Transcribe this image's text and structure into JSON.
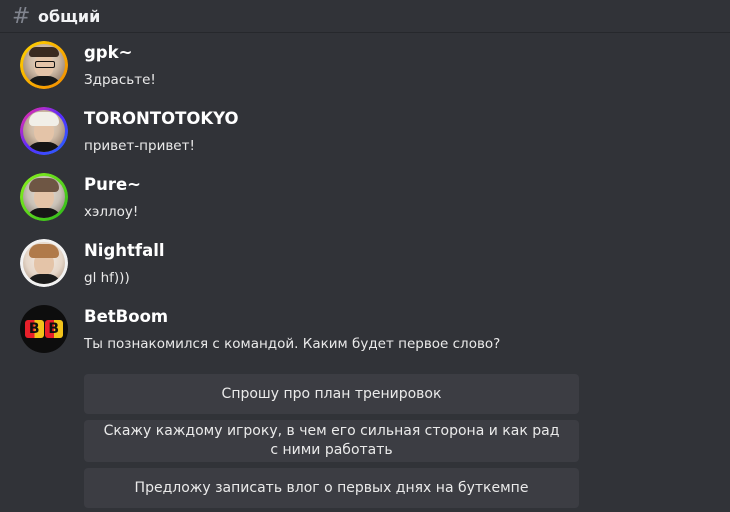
{
  "channel": {
    "hash_icon": "hash-icon",
    "name": "общий"
  },
  "messages": [
    {
      "username": "gpk~",
      "text": "Здрасьте!",
      "avatar_ring": "#f5b400"
    },
    {
      "username": "TORONTOTOKYO",
      "text": "привет-привет!",
      "avatar_ring": "#7b3cff"
    },
    {
      "username": "Pure~",
      "text": "хэллоу!",
      "avatar_ring": "#4cd41e"
    },
    {
      "username": "Nightfall",
      "text": "gl hf)))",
      "avatar_ring": "#ffffff"
    },
    {
      "username": "BetBoom",
      "text": "Ты познакомился с командой. Каким будет первое слово?",
      "avatar_logo": "BB"
    }
  ],
  "choices": [
    {
      "label": "Спрошу про план тренировок"
    },
    {
      "label": "Скажу каждому игроку, в чем его сильная сторона и как рад с ними работать"
    },
    {
      "label": "Предложу записать влог о первых днях на буткемпе"
    }
  ]
}
